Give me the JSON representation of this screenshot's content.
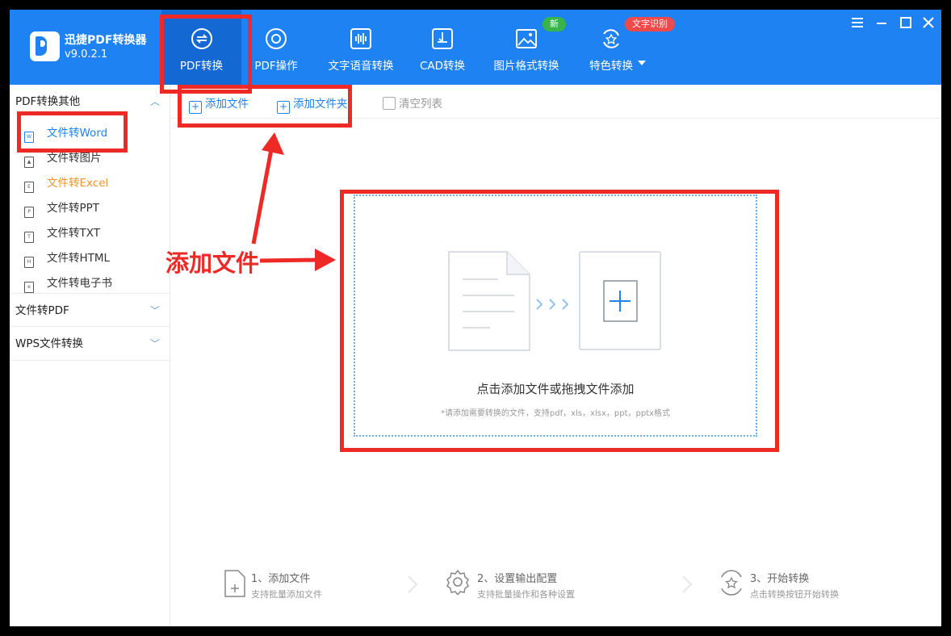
{
  "app": {
    "name": "迅捷PDF转换器",
    "version": "v9.0.2.1"
  },
  "nav": {
    "items": [
      {
        "label": "PDF转换",
        "icon": "convert-icon",
        "active": true
      },
      {
        "label": "PDF操作",
        "icon": "settings-circle-icon"
      },
      {
        "label": "文字语音转换",
        "icon": "waveform-icon"
      },
      {
        "label": "CAD转换",
        "icon": "cad-icon"
      },
      {
        "label": "图片格式转换",
        "icon": "image-icon"
      },
      {
        "label": "特色转换",
        "icon": "star-refresh-icon"
      }
    ],
    "badge_new": "新",
    "badge_ocr": "文字识别"
  },
  "window_controls": [
    "menu-icon",
    "minimize-icon",
    "maximize-icon",
    "close-icon"
  ],
  "sidebar": {
    "group1": "PDF转换其他",
    "items": [
      {
        "label": "文件转Word",
        "icon": "W"
      },
      {
        "label": "文件转图片",
        "icon": "img"
      },
      {
        "label": "文件转Excel",
        "icon": "E"
      },
      {
        "label": "文件转PPT",
        "icon": "P"
      },
      {
        "label": "文件转TXT",
        "icon": "T"
      },
      {
        "label": "文件转HTML",
        "icon": "H"
      },
      {
        "label": "文件转电子书",
        "icon": "e"
      }
    ],
    "group2": "文件转PDF",
    "group3": "WPS文件转换"
  },
  "toolbar": {
    "add_file": "添加文件",
    "add_folder": "添加文件夹",
    "clear_list": "清空列表"
  },
  "dropzone": {
    "title": "点击添加文件或拖拽文件添加",
    "subtitle": "*请添加需要转换的文件，支持pdf，xls，xlsx，ppt，pptx格式"
  },
  "steps": [
    {
      "title": "1、添加文件",
      "sub": "支持批量添加文件"
    },
    {
      "title": "2、设置输出配置",
      "sub": "支持批量操作和各种设置"
    },
    {
      "title": "3、开始转换",
      "sub": "点击转换按钮开始转换"
    }
  ],
  "annotation": {
    "text": "添加文件",
    "color": "#ee2a27"
  },
  "colors": {
    "brand": "#1e82f3",
    "active_nav": "#1468d4",
    "excel": "#f0942e"
  }
}
